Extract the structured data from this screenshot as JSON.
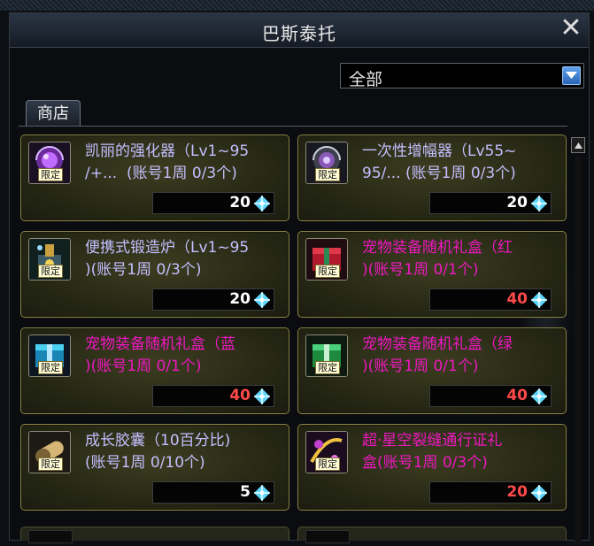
{
  "window": {
    "title": "巴斯泰托",
    "close_label": "✕"
  },
  "filter": {
    "selected": "全部"
  },
  "tabs": [
    {
      "label": "商店"
    }
  ],
  "colors": {
    "name_normal": "#c4bfff",
    "name_pet": "#ee18c0",
    "price_normal": "#ffffff",
    "price_limited": "#ff4a4a",
    "item_border": "#8a8445"
  },
  "items": [
    {
      "line1": "凯丽的强化器（Lv1~95",
      "line2": "/+...  (账号1周 0/3个)",
      "limit": "限定",
      "price": "20",
      "icon": "purple-orb-icon",
      "kind": "normal"
    },
    {
      "line1": "一次性增幅器（Lv55~",
      "line2": "95/... (账号1周 0/3个)",
      "limit": "限定",
      "price": "20",
      "icon": "amplifier-orb-icon",
      "kind": "normal"
    },
    {
      "line1": "便携式锻造炉（Lv1~95",
      "line2": ")(账号1周 0/3个)",
      "limit": "限定",
      "price": "20",
      "icon": "forge-icon",
      "kind": "normal"
    },
    {
      "line1": "宠物装备随机礼盒（红",
      "line2": ")(账号1周 0/1个)",
      "limit": "限定",
      "price": "40",
      "icon": "red-gift-box-icon",
      "kind": "pet"
    },
    {
      "line1": "宠物装备随机礼盒（蓝",
      "line2": ")(账号1周 0/1个)",
      "limit": "限定",
      "price": "40",
      "icon": "blue-gift-box-icon",
      "kind": "pet"
    },
    {
      "line1": "宠物装备随机礼盒（绿",
      "line2": ")(账号1周 0/1个)",
      "limit": "限定",
      "price": "40",
      "icon": "green-gift-box-icon",
      "kind": "pet"
    },
    {
      "line1": "成长胶囊（10百分比)",
      "line2": "(账号1周 0/10个)",
      "limit": "限定",
      "price": "5",
      "icon": "capsule-icon",
      "kind": "normal"
    },
    {
      "line1": "超·星空裂缝通行证礼",
      "line2": "盒(账号1周 0/3个)",
      "limit": "限定",
      "price": "20",
      "icon": "pass-gift-icon",
      "kind": "pet"
    }
  ]
}
